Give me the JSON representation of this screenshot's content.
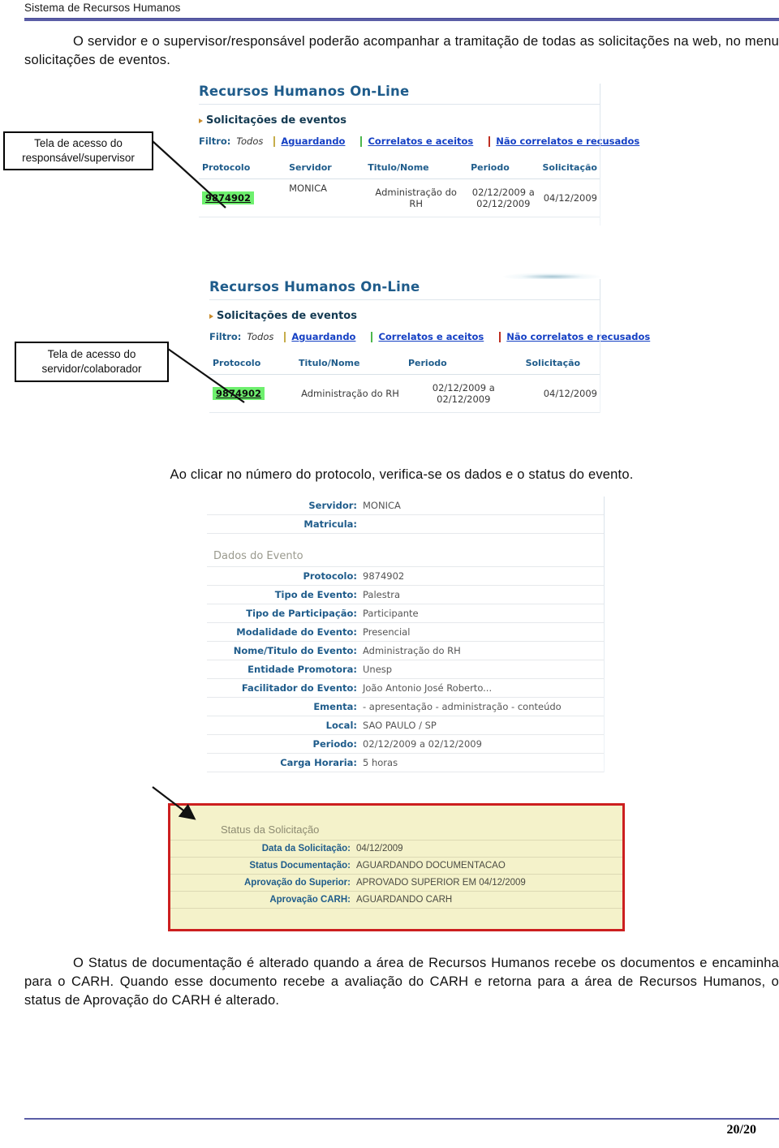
{
  "document": {
    "running_head": "Sistema de Recursos Humanos",
    "page_number": "20/20"
  },
  "paragraphs": {
    "intro": "O servidor e o supervisor/responsável poderão acompanhar a tramitação de todas as solicitações na web, no menu solicitações de eventos.",
    "click_protocol": "Ao clicar no número do protocolo, verifica-se os dados e o status do evento.",
    "status_explain": "O Status de documentação é alterado quando a área de Recursos Humanos recebe os documentos e encaminha para o CARH. Quando esse documento recebe a avaliação do CARH e retorna para a área de Recursos Humanos, o status de Aprovação do CARH é alterado."
  },
  "callouts": {
    "supervisor": "Tela de acesso do responsável/supervisor",
    "servidor": "Tela de acesso do servidor/colaborador"
  },
  "screenshot_supervisor": {
    "app_title": "Recursos Humanos On-Line",
    "section": "Solicitações de eventos",
    "filter_label": "Filtro:",
    "filter_current": "Todos",
    "filter_options": [
      {
        "label": "Aguardando",
        "color": "#f2d45c"
      },
      {
        "label": "Correlatos e aceitos",
        "color": "#5ee05e"
      },
      {
        "label": "Não correlatos e recusados",
        "color": "#e83a2a"
      }
    ],
    "columns": [
      "Protocolo",
      "Servidor",
      "Titulo/Nome",
      "Periodo",
      "Solicitação"
    ],
    "rows": [
      {
        "protocolo": "9874902",
        "servidor": "MONICA",
        "titulo": "Administração do RH",
        "periodo_line1": "02/12/2009 a",
        "periodo_line2": "02/12/2009",
        "solicitacao": "04/12/2009"
      }
    ]
  },
  "screenshot_servidor": {
    "app_title": "Recursos Humanos On-Line",
    "section": "Solicitações de eventos",
    "filter_label": "Filtro:",
    "filter_current": "Todos",
    "filter_options": [
      {
        "label": "Aguardando",
        "color": "#f2d45c"
      },
      {
        "label": "Correlatos e aceitos",
        "color": "#5ee05e"
      },
      {
        "label": "Não correlatos e recusados",
        "color": "#e83a2a"
      }
    ],
    "columns": [
      "Protocolo",
      "Titulo/Nome",
      "Periodo",
      "Solicitação"
    ],
    "rows": [
      {
        "protocolo": "9874902",
        "titulo": "Administração do RH",
        "periodo": "02/12/2009 a 02/12/2009",
        "solicitacao": "04/12/2009"
      }
    ]
  },
  "screenshot_detail": {
    "header_fields": [
      {
        "label": "Servidor:",
        "value": "MONICA"
      },
      {
        "label": "Matricula:",
        "value": ""
      }
    ],
    "event_group_title": "Dados do Evento",
    "event_fields": [
      {
        "label": "Protocolo:",
        "value": "9874902"
      },
      {
        "label": "Tipo de Evento:",
        "value": "Palestra"
      },
      {
        "label": "Tipo de Participação:",
        "value": "Participante"
      },
      {
        "label": "Modalidade do Evento:",
        "value": "Presencial"
      },
      {
        "label": "Nome/Titulo do Evento:",
        "value": "Administração do RH"
      },
      {
        "label": "Entidade Promotora:",
        "value": "Unesp"
      },
      {
        "label": "Facilitador do Evento:",
        "value": "João Antonio José Roberto..."
      },
      {
        "label": "Ementa:",
        "value": "- apresentação - administração - conteúdo"
      },
      {
        "label": "Local:",
        "value": "SAO PAULO / SP"
      },
      {
        "label": "Periodo:",
        "value": "02/12/2009 a 02/12/2009"
      },
      {
        "label": "Carga Horaria:",
        "value": "5 horas"
      }
    ],
    "status_group_title": "Status da Solicitação",
    "status_fields": [
      {
        "label": "Data da Solicitação:",
        "value": "04/12/2009"
      },
      {
        "label": "Status Documentação:",
        "value": "AGUARDANDO DOCUMENTACAO"
      },
      {
        "label": "Aprovação do Superior:",
        "value": "APROVADO SUPERIOR EM 04/12/2009"
      },
      {
        "label": "Aprovação CARH:",
        "value": "AGUARDANDO CARH"
      }
    ],
    "highlight_color": "#cc1f1f"
  }
}
